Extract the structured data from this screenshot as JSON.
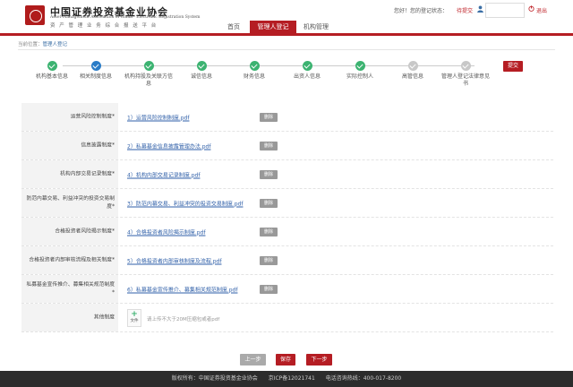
{
  "header": {
    "org_cn": "中国证券投资基金业协会",
    "org_en": "Asset Management Association of China · Electronic Registration System",
    "org_sub": "资 产 管 理 业 务 综 合 报 送 平 台",
    "nav": [
      "首页",
      "管理人登记",
      "机构管理"
    ],
    "greeting": "您好！您的登记状态：",
    "status": "待提交",
    "logout": "退出"
  },
  "breadcrumb": {
    "prefix": "当前位置：",
    "link": "管理人登记"
  },
  "steps": [
    {
      "label": "机构基本信息",
      "state": "done"
    },
    {
      "label": "相关制度信息",
      "state": "current"
    },
    {
      "label": "机构持股及关联方信息",
      "state": "done"
    },
    {
      "label": "诚信信息",
      "state": "done"
    },
    {
      "label": "财务信息",
      "state": "done"
    },
    {
      "label": "出资人信息",
      "state": "done"
    },
    {
      "label": "实际控制人",
      "state": "done"
    },
    {
      "label": "高管信息",
      "state": "todo"
    },
    {
      "label": "管理人登记法律意见书",
      "state": "todo"
    }
  ],
  "submit_label": "提交",
  "rows": [
    {
      "label": "运营风险控制制度*",
      "file": "1）运营风险控制制度.pdf",
      "delete": "删除"
    },
    {
      "label": "信息披露制度*",
      "file": "2）私募基金信息披露管理办法.pdf",
      "delete": "删除"
    },
    {
      "label": "机构内部交易记录制度*",
      "file": "4）机构内部交易记录制度.pdf",
      "delete": "删除"
    },
    {
      "label": "防范内幕交易、利益冲突的投资交易制度*",
      "file": "3）防范内幕交易、利益冲突的投资交易制度.pdf",
      "delete": "删除"
    },
    {
      "label": "合格投资者风险揭示制度*",
      "file": "4）合格投资者风险揭示制度.pdf",
      "delete": "删除"
    },
    {
      "label": "合格投资者内部审核流程及相关制度*",
      "file": "5）合格投资者内部审核制度及流程.pdf",
      "delete": "删除"
    },
    {
      "label": "私募基金宣传推介、募集相关规范制度*",
      "file": "6）私募基金宣传推介、募集相关规范制度.pdf",
      "delete": "删除"
    }
  ],
  "other": {
    "label": "其他制度",
    "add_label": "文件",
    "hint": "请上传不大于20M压缩包或者pdf"
  },
  "buttons": {
    "prev": "上一步",
    "save": "保存",
    "next": "下一步"
  },
  "footer": {
    "copyright": "版权所有：中国证券投资基金业协会",
    "icp": "京ICP备12021741",
    "hotline": "电话咨询热线：400-017-8200"
  },
  "colors": {
    "brand_red": "#b51d23",
    "done_green": "#3cb371",
    "current_blue": "#2a7cc7"
  }
}
